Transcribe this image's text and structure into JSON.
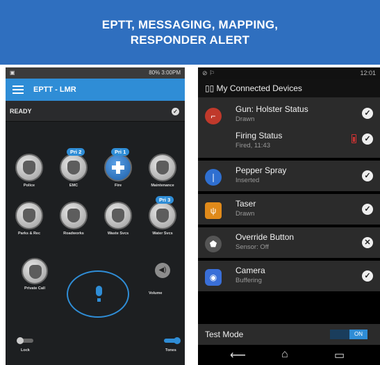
{
  "banner": {
    "line1": "EPTT, MESSAGING, MAPPING,",
    "line2": "RESPONDER ALERT"
  },
  "left_phone": {
    "status_right": "80% 3:00PM",
    "app_title": "EPTT - LMR",
    "ready_label": "READY",
    "tiles": [
      {
        "label": "Police",
        "badge": ""
      },
      {
        "label": "EMC",
        "badge": "Pri 2"
      },
      {
        "label": "Fire",
        "badge": "Pri 1"
      },
      {
        "label": "Maintenance",
        "badge": ""
      },
      {
        "label": "Parks & Rec",
        "badge": ""
      },
      {
        "label": "Roadworks",
        "badge": ""
      },
      {
        "label": "Waste Svcs",
        "badge": ""
      },
      {
        "label": "Water Svcs",
        "badge": "Pri 3"
      }
    ],
    "private_call": "Private Call",
    "volume": "Volume",
    "lock": "Lock",
    "tones": "Tones"
  },
  "right_phone": {
    "time": "12:01",
    "header": "My Connected Devices",
    "devices": [
      {
        "name": "Gun: Holster Status",
        "status": "Drawn",
        "icon": "gun-icon",
        "color": "#c0392b"
      },
      {
        "name": "Firing Status",
        "status": "Fired, 11:43"
      },
      {
        "name": "Pepper Spray",
        "status": "Inserted",
        "icon": "pepper-spray-icon",
        "color": "#2f6fd0"
      },
      {
        "name": "Taser",
        "status": "Drawn",
        "icon": "taser-icon",
        "color": "#e08a1a"
      },
      {
        "name": "Override Button",
        "status": "Sensor: Off",
        "icon": "override-icon",
        "color": "#555555"
      },
      {
        "name": "Camera",
        "status": "Buffering",
        "icon": "camera-icon",
        "color": "#3a6fd8"
      }
    ],
    "test_mode": "Test Mode",
    "toggle": "ON"
  }
}
